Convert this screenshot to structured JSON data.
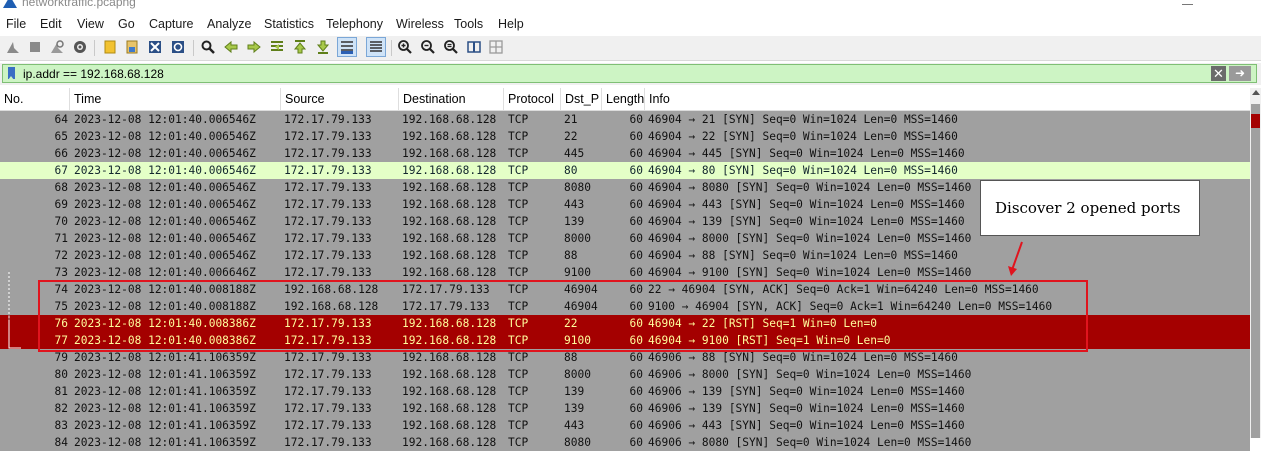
{
  "window": {
    "title": "networktraffic.pcapng"
  },
  "menu": [
    "File",
    "Edit",
    "View",
    "Go",
    "Capture",
    "Analyze",
    "Statistics",
    "Telephony",
    "Wireless",
    "Tools",
    "Help"
  ],
  "toolbar_icons": [
    "shark-fin-start-icon",
    "stop-icon",
    "restart-icon",
    "options-gear-icon",
    "open-file-icon",
    "save-file-icon",
    "close-file-icon",
    "reload-icon",
    "find-icon",
    "back-icon",
    "forward-icon",
    "go-to-packet-icon",
    "first-packet-icon",
    "last-packet-icon",
    "autoscroll-icon",
    "colorize-icon",
    "zoom-in-icon",
    "zoom-out-icon",
    "zoom-normal-icon",
    "resize-columns-icon",
    "layout-icon"
  ],
  "filter": {
    "value": "ip.addr == 192.168.68.128",
    "background": "#cdf4c4"
  },
  "columns": [
    "No.",
    "Time",
    "Source",
    "Destination",
    "Protocol",
    "Dst_P",
    "Length",
    "Info"
  ],
  "packets": [
    {
      "no": "64",
      "time": "2023-12-08 12:01:40.006546Z",
      "src": "172.17.79.133",
      "dst": "192.168.68.128",
      "proto": "TCP",
      "dport": "21",
      "len": "60",
      "info": "46904 → 21 [SYN] Seq=0 Win=1024 Len=0 MSS=1460",
      "style": "gray"
    },
    {
      "no": "65",
      "time": "2023-12-08 12:01:40.006546Z",
      "src": "172.17.79.133",
      "dst": "192.168.68.128",
      "proto": "TCP",
      "dport": "22",
      "len": "60",
      "info": "46904 → 22 [SYN] Seq=0 Win=1024 Len=0 MSS=1460",
      "style": "gray"
    },
    {
      "no": "66",
      "time": "2023-12-08 12:01:40.006546Z",
      "src": "172.17.79.133",
      "dst": "192.168.68.128",
      "proto": "TCP",
      "dport": "445",
      "len": "60",
      "info": "46904 → 445 [SYN] Seq=0 Win=1024 Len=0 MSS=1460",
      "style": "gray"
    },
    {
      "no": "67",
      "time": "2023-12-08 12:01:40.006546Z",
      "src": "172.17.79.133",
      "dst": "192.168.68.128",
      "proto": "TCP",
      "dport": "80",
      "len": "60",
      "info": "46904 → 80 [SYN] Seq=0 Win=1024 Len=0 MSS=1460",
      "style": "green"
    },
    {
      "no": "68",
      "time": "2023-12-08 12:01:40.006546Z",
      "src": "172.17.79.133",
      "dst": "192.168.68.128",
      "proto": "TCP",
      "dport": "8080",
      "len": "60",
      "info": "46904 → 8080 [SYN] Seq=0 Win=1024 Len=0 MSS=1460",
      "style": "gray"
    },
    {
      "no": "69",
      "time": "2023-12-08 12:01:40.006546Z",
      "src": "172.17.79.133",
      "dst": "192.168.68.128",
      "proto": "TCP",
      "dport": "443",
      "len": "60",
      "info": "46904 → 443 [SYN] Seq=0 Win=1024 Len=0 MSS=1460",
      "style": "gray"
    },
    {
      "no": "70",
      "time": "2023-12-08 12:01:40.006546Z",
      "src": "172.17.79.133",
      "dst": "192.168.68.128",
      "proto": "TCP",
      "dport": "139",
      "len": "60",
      "info": "46904 → 139 [SYN] Seq=0 Win=1024 Len=0 MSS=1460",
      "style": "gray"
    },
    {
      "no": "71",
      "time": "2023-12-08 12:01:40.006546Z",
      "src": "172.17.79.133",
      "dst": "192.168.68.128",
      "proto": "TCP",
      "dport": "8000",
      "len": "60",
      "info": "46904 → 8000 [SYN] Seq=0 Win=1024 Len=0 MSS=1460",
      "style": "gray"
    },
    {
      "no": "72",
      "time": "2023-12-08 12:01:40.006546Z",
      "src": "172.17.79.133",
      "dst": "192.168.68.128",
      "proto": "TCP",
      "dport": "88",
      "len": "60",
      "info": "46904 → 88 [SYN] Seq=0 Win=1024 Len=0 MSS=1460",
      "style": "gray"
    },
    {
      "no": "73",
      "time": "2023-12-08 12:01:40.006646Z",
      "src": "172.17.79.133",
      "dst": "192.168.68.128",
      "proto": "TCP",
      "dport": "9100",
      "len": "60",
      "info": "46904 → 9100 [SYN] Seq=0 Win=1024 Len=0 MSS=1460",
      "style": "gray"
    },
    {
      "no": "74",
      "time": "2023-12-08 12:01:40.008188Z",
      "src": "192.168.68.128",
      "dst": "172.17.79.133",
      "proto": "TCP",
      "dport": "46904",
      "len": "60",
      "info": "22 → 46904 [SYN, ACK] Seq=0 Ack=1 Win=64240 Len=0 MSS=1460",
      "style": "gray"
    },
    {
      "no": "75",
      "time": "2023-12-08 12:01:40.008188Z",
      "src": "192.168.68.128",
      "dst": "172.17.79.133",
      "proto": "TCP",
      "dport": "46904",
      "len": "60",
      "info": "9100 → 46904 [SYN, ACK] Seq=0 Ack=1 Win=64240 Len=0 MSS=1460",
      "style": "gray"
    },
    {
      "no": "76",
      "time": "2023-12-08 12:01:40.008386Z",
      "src": "172.17.79.133",
      "dst": "192.168.68.128",
      "proto": "TCP",
      "dport": "22",
      "len": "60",
      "info": "46904 → 22 [RST] Seq=1 Win=0 Len=0",
      "style": "red"
    },
    {
      "no": "77",
      "time": "2023-12-08 12:01:40.008386Z",
      "src": "172.17.79.133",
      "dst": "192.168.68.128",
      "proto": "TCP",
      "dport": "9100",
      "len": "60",
      "info": "46904 → 9100 [RST] Seq=1 Win=0 Len=0",
      "style": "red"
    },
    {
      "no": "79",
      "time": "2023-12-08 12:01:41.106359Z",
      "src": "172.17.79.133",
      "dst": "192.168.68.128",
      "proto": "TCP",
      "dport": "88",
      "len": "60",
      "info": "46906 → 88 [SYN] Seq=0 Win=1024 Len=0 MSS=1460",
      "style": "gray"
    },
    {
      "no": "80",
      "time": "2023-12-08 12:01:41.106359Z",
      "src": "172.17.79.133",
      "dst": "192.168.68.128",
      "proto": "TCP",
      "dport": "8000",
      "len": "60",
      "info": "46906 → 8000 [SYN] Seq=0 Win=1024 Len=0 MSS=1460",
      "style": "gray"
    },
    {
      "no": "81",
      "time": "2023-12-08 12:01:41.106359Z",
      "src": "172.17.79.133",
      "dst": "192.168.68.128",
      "proto": "TCP",
      "dport": "139",
      "len": "60",
      "info": "46906 → 139 [SYN] Seq=0 Win=1024 Len=0 MSS=1460",
      "style": "gray"
    },
    {
      "no": "82",
      "time": "2023-12-08 12:01:41.106359Z",
      "src": "172.17.79.133",
      "dst": "192.168.68.128",
      "proto": "TCP",
      "dport": "139",
      "len": "60",
      "info": "46906 → 139 [SYN] Seq=0 Win=1024 Len=0 MSS=1460",
      "style": "gray"
    },
    {
      "no": "83",
      "time": "2023-12-08 12:01:41.106359Z",
      "src": "172.17.79.133",
      "dst": "192.168.68.128",
      "proto": "TCP",
      "dport": "443",
      "len": "60",
      "info": "46906 → 443 [SYN] Seq=0 Win=1024 Len=0 MSS=1460",
      "style": "gray"
    },
    {
      "no": "84",
      "time": "2023-12-08 12:01:41.106359Z",
      "src": "172.17.79.133",
      "dst": "192.168.68.128",
      "proto": "TCP",
      "dport": "8080",
      "len": "60",
      "info": "46906 → 8080 [SYN] Seq=0 Win=1024 Len=0 MSS=1460",
      "style": "gray"
    }
  ],
  "row_colors": {
    "gray": {
      "bg": "#a0a0a0",
      "fg": "#111111"
    },
    "green": {
      "bg": "#e4ffc7",
      "fg": "#12272e"
    },
    "red": {
      "bg": "#a40000",
      "fg": "#fffc9c"
    }
  },
  "annotation": {
    "callout_text": "Discover 2 opened ports",
    "highlight_color": "#e0141e"
  }
}
